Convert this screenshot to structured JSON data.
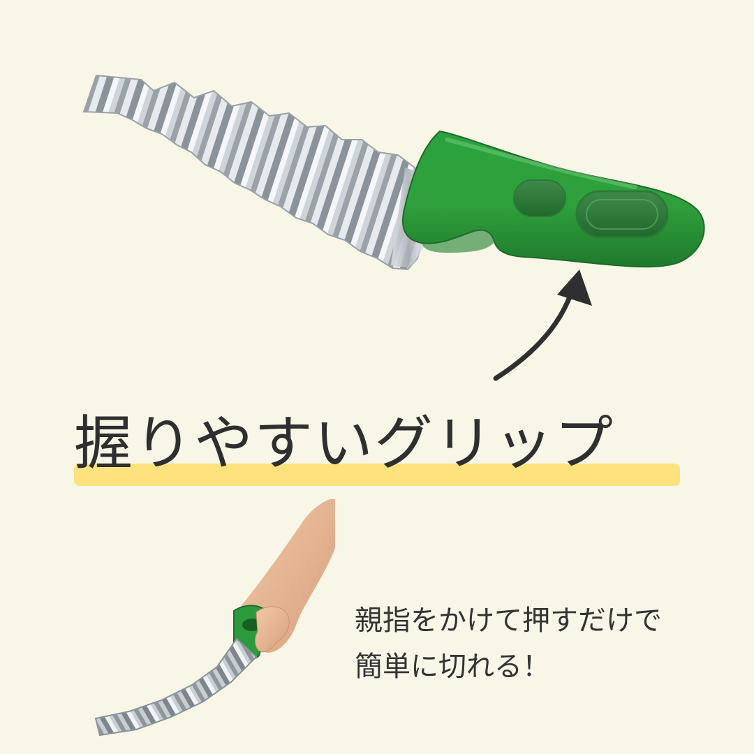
{
  "headline": "握りやすいグリップ",
  "caption": {
    "line1": "親指をかけて押すだけで",
    "line2": "簡単に切れる！"
  },
  "colors": {
    "background": "#f8f7e7",
    "highlight": "#fde27e",
    "handle_green": "#2e9a3e",
    "text": "#2f2f2f"
  },
  "icons": {
    "arrow": "curved-arrow-up-icon"
  }
}
